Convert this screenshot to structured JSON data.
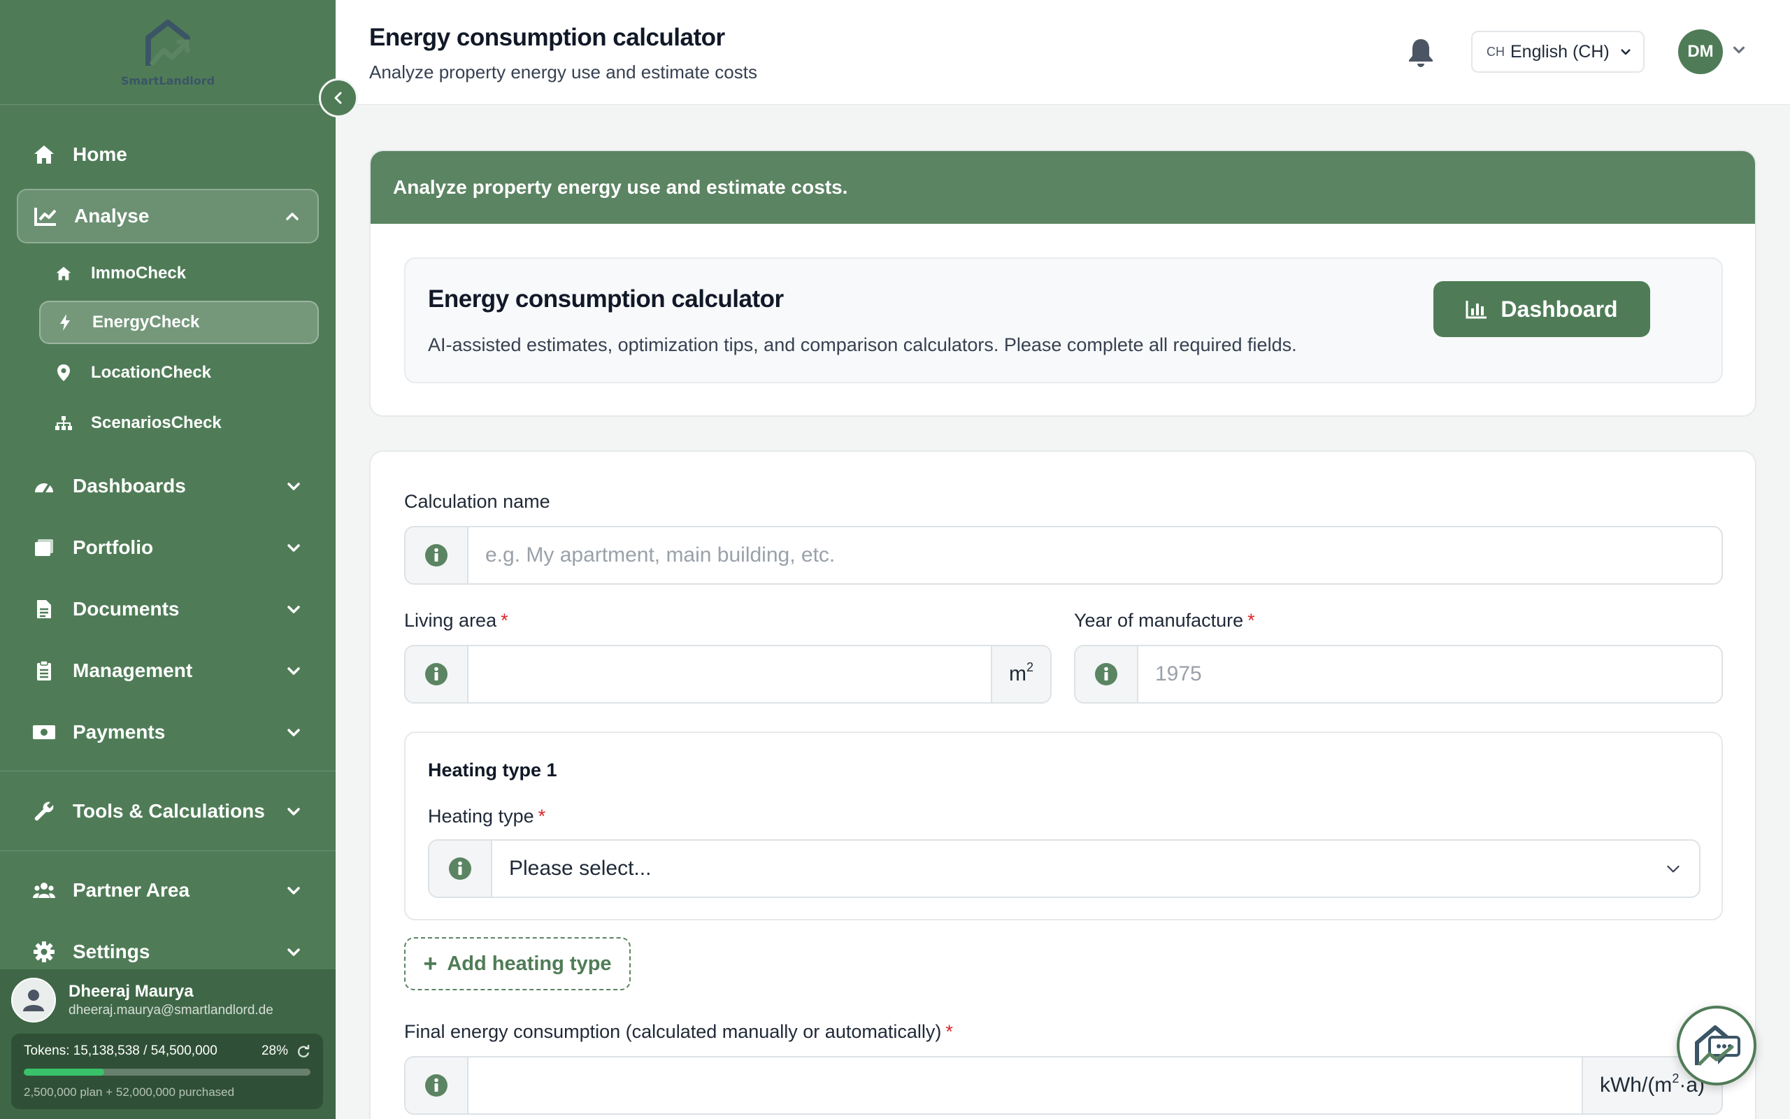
{
  "brand": {
    "name": "SmartLandlord"
  },
  "sidebar": {
    "nav": [
      {
        "label": "Home",
        "icon": "home-icon"
      },
      {
        "label": "Analyse",
        "icon": "chart-line-icon",
        "expanded": true
      },
      {
        "label": "Dashboards",
        "icon": "gauge-icon"
      },
      {
        "label": "Portfolio",
        "icon": "portfolio-icon"
      },
      {
        "label": "Documents",
        "icon": "document-icon"
      },
      {
        "label": "Management",
        "icon": "clipboard-icon"
      },
      {
        "label": "Payments",
        "icon": "money-icon"
      },
      {
        "label": "Tools & Calculations",
        "icon": "wrench-icon"
      },
      {
        "label": "Partner Area",
        "icon": "users-icon"
      },
      {
        "label": "Settings",
        "icon": "gear-icon"
      }
    ],
    "analyse_sub": [
      {
        "label": "ImmoCheck",
        "icon": "home-icon"
      },
      {
        "label": "EnergyCheck",
        "icon": "bolt-icon",
        "active": true
      },
      {
        "label": "LocationCheck",
        "icon": "map-pin-icon"
      },
      {
        "label": "ScenariosCheck",
        "icon": "sitemap-icon"
      }
    ],
    "user": {
      "name": "Dheeraj Maurya",
      "email": "dheeraj.maurya@smartlandlord.de"
    },
    "tokens": {
      "label": "Tokens: 15,138,538 / 54,500,000",
      "percent_label": "28%",
      "fraction": 0.28,
      "breakdown": "2,500,000 plan + 52,000,000 purchased"
    }
  },
  "header": {
    "title": "Energy consumption calculator",
    "subtitle": "Analyze property energy use and estimate costs",
    "language": {
      "code": "CH",
      "label": "English (CH)"
    },
    "avatar_initials": "DM"
  },
  "banner": {
    "heading": "Analyze property energy use and estimate costs.",
    "intro_title": "Energy consumption calculator",
    "intro_desc": "AI-assisted estimates, optimization tips, and comparison calculators. Please complete all required fields.",
    "dashboard_button": "Dashboard"
  },
  "form": {
    "calc_name_label": "Calculation name",
    "calc_name_placeholder": "e.g. My apartment, main building, etc.",
    "living_area_label": "Living area",
    "living_area_unit": "m",
    "living_area_unit_sup": "2",
    "year_label": "Year of manufacture",
    "year_placeholder": "1975",
    "heating_group_title": "Heating type 1",
    "heating_type_label": "Heating type",
    "heating_type_value": "Please select...",
    "add_heating_label": "Add heating type",
    "final_energy_label": "Final energy consumption (calculated manually or automatically)",
    "final_energy_unit_a": "kWh/(m",
    "final_energy_unit_sup": "2",
    "final_energy_unit_b": "·a)",
    "required_mark": "*"
  },
  "colors": {
    "sidebar": "#4f7c57",
    "accent": "#5b8462",
    "required": "#dc2626",
    "token_bar": "#39c26a"
  }
}
